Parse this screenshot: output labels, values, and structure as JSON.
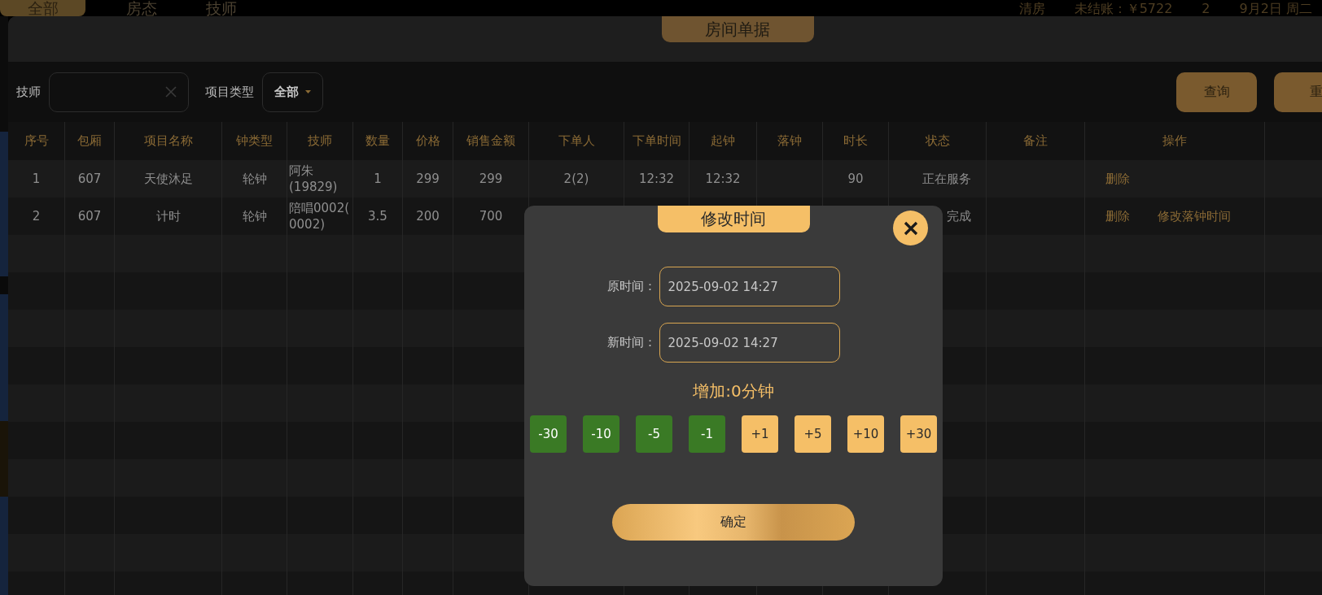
{
  "top_bar": {
    "tabs": [
      {
        "label": "全部",
        "selected": true
      },
      {
        "label": "房态",
        "selected": false
      },
      {
        "label": "技师",
        "selected": false
      }
    ],
    "items": [
      "清房",
      "未结账：￥5722",
      "2",
      "9月2日 周二"
    ]
  },
  "panel": {
    "title": "房间单据",
    "filters": {
      "technician_label": "技师",
      "project_type_label": "项目类型",
      "project_type_value": "全部"
    },
    "buttons": [
      "查询",
      "重"
    ],
    "table": {
      "columns": [
        "序号",
        "包厢",
        "项目名称",
        "钟类型",
        "技师",
        "数量",
        "价格",
        "销售金额",
        "下单人",
        "下单时间",
        "起钟",
        "落钟",
        "时长",
        "状态",
        "备注",
        "操作"
      ],
      "rows": [
        {
          "cells": [
            "1",
            "607",
            "天使沐足",
            "轮钟",
            "阿朱\n(19829)",
            "1",
            "299",
            "299",
            "2(2)",
            "12:32",
            "12:32",
            null,
            "90",
            "正在服务",
            null
          ],
          "actions": [
            "删除"
          ]
        },
        {
          "cells": [
            "2",
            "607",
            "计时",
            "轮钟",
            "陪唱0002(\n0002)",
            "3.5",
            "200",
            "700",
            null,
            null,
            null,
            null,
            null,
            "完成",
            null
          ],
          "actions": [
            "删除",
            "修改落钟时间"
          ]
        }
      ]
    }
  },
  "modal": {
    "title": "修改时间",
    "fields": [
      {
        "label": "原时间：",
        "value": "2025-09-02 14:27"
      },
      {
        "label": "新时间：",
        "value": "2025-09-02 14:27"
      }
    ],
    "summary": "增加:0分钟",
    "adjust_buttons": [
      {
        "label": "-30",
        "kind": "minus"
      },
      {
        "label": "-10",
        "kind": "minus"
      },
      {
        "label": "-5",
        "kind": "minus"
      },
      {
        "label": "-1",
        "kind": "minus"
      },
      {
        "label": "+1",
        "kind": "plus"
      },
      {
        "label": "+5",
        "kind": "plus"
      },
      {
        "label": "+10",
        "kind": "plus"
      },
      {
        "label": "+30",
        "kind": "plus"
      }
    ],
    "confirm": "确定"
  }
}
